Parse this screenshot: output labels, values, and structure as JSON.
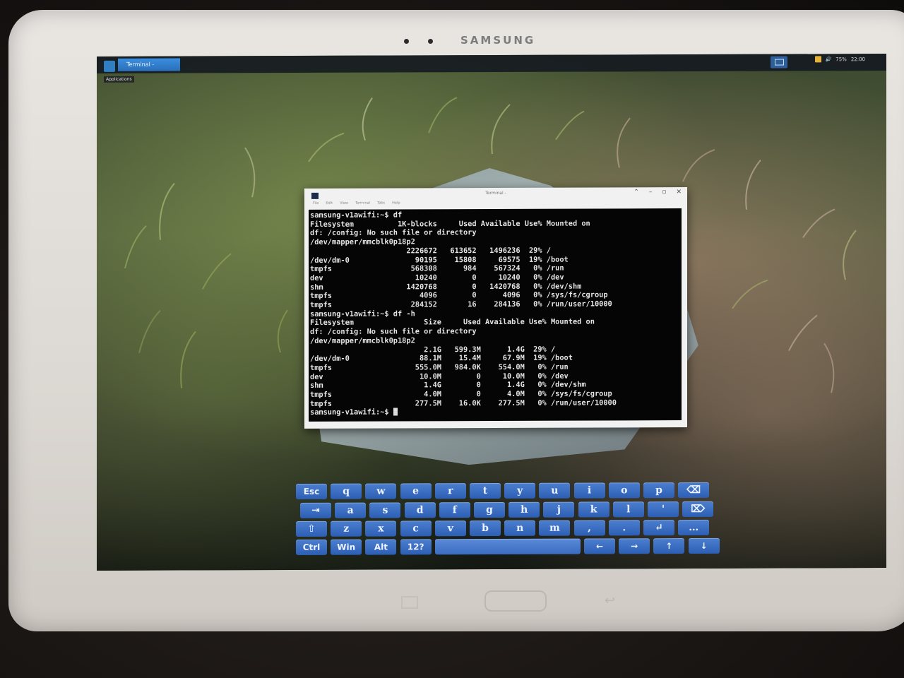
{
  "device": {
    "brand": "SAMSUNG"
  },
  "panel": {
    "task_label": "Terminal -",
    "applications_label": "Applications",
    "battery": "75%",
    "clock": "22:00"
  },
  "terminal": {
    "title": "Terminal -",
    "menu": [
      "File",
      "Edit",
      "View",
      "Terminal",
      "Tabs",
      "Help"
    ],
    "lines": [
      "samsung-v1awifi:~$ df",
      "Filesystem          1K-blocks     Used Available Use% Mounted on",
      "df: /config: No such file or directory",
      "/dev/mapper/mmcblk0p18p2",
      "                      2226672   613652   1496236  29% /",
      "/dev/dm-0               90195    15808     69575  19% /boot",
      "tmpfs                  568308      984    567324   0% /run",
      "dev                     10240        0     10240   0% /dev",
      "shm                   1420768        0   1420768   0% /dev/shm",
      "tmpfs                    4096        0      4096   0% /sys/fs/cgroup",
      "tmpfs                  284152       16    284136   0% /run/user/10000",
      "samsung-v1awifi:~$ df -h",
      "Filesystem                Size     Used Available Use% Mounted on",
      "df: /config: No such file or directory",
      "/dev/mapper/mmcblk0p18p2",
      "                          2.1G   599.3M      1.4G  29% /",
      "/dev/dm-0                88.1M    15.4M     67.9M  19% /boot",
      "tmpfs                   555.0M   984.0K    554.0M   0% /run",
      "dev                      10.0M        0     10.0M   0% /dev",
      "shm                       1.4G        0      1.4G   0% /dev/shm",
      "tmpfs                     4.0M        0      4.0M   0% /sys/fs/cgroup",
      "tmpfs                   277.5M    16.0K    277.5M   0% /run/user/10000"
    ],
    "prompt": "samsung-v1awifi:~$ "
  },
  "keyboard": {
    "rows": [
      [
        "Esc",
        "q",
        "w",
        "e",
        "r",
        "t",
        "y",
        "u",
        "i",
        "o",
        "p",
        "⌫"
      ],
      [
        "⇥",
        "a",
        "s",
        "d",
        "f",
        "g",
        "h",
        "j",
        "k",
        "l",
        "'",
        "⌦"
      ],
      [
        "⇧",
        "z",
        "x",
        "c",
        "v",
        "b",
        "n",
        "m",
        ",",
        ".",
        "↵",
        "…"
      ],
      [
        "Ctrl",
        "Win",
        "Alt",
        "12?",
        "",
        "←",
        "→",
        "↑",
        "↓"
      ]
    ]
  }
}
